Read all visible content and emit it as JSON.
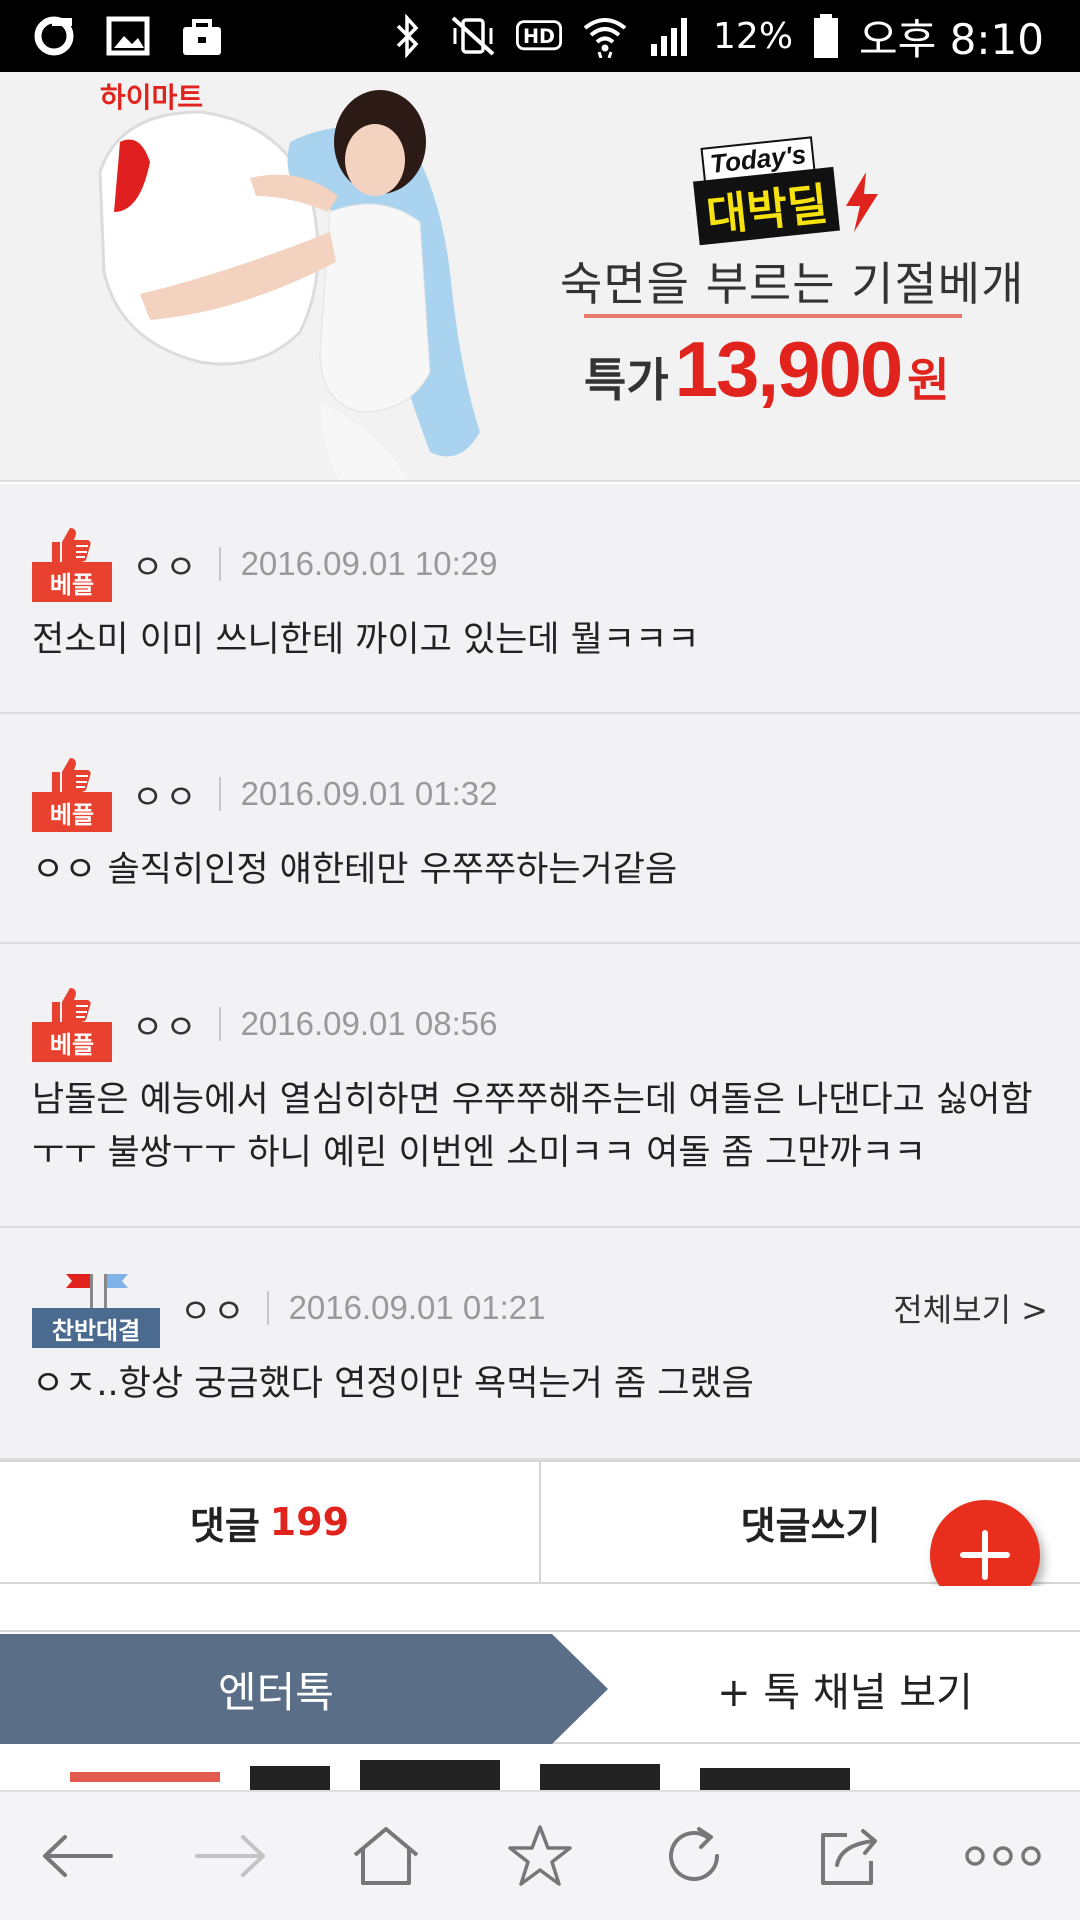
{
  "status_bar": {
    "battery_percent": "12%",
    "time": "오후 8:10",
    "icons": [
      "o-icon",
      "gallery-icon",
      "bag-icon",
      "bluetooth-icon",
      "vibrate-icon",
      "hd-icon",
      "wifi-icon",
      "signal-icon",
      "battery-icon"
    ]
  },
  "ad": {
    "brand": "하이마트",
    "deal_top": "Today's",
    "deal_main": "대박딜",
    "headline": "숙면을 부르는 기절베개",
    "price_label": "특가",
    "price_value": "13,900",
    "price_unit": "원"
  },
  "comments": [
    {
      "badge": "베플",
      "author": "ㅇㅇ",
      "date": "2016.09.01 10:29",
      "text": "전소미 이미 쓰니한테 까이고 있는데 뭘ㅋㅋㅋ"
    },
    {
      "badge": "베플",
      "author": "ㅇㅇ",
      "date": "2016.09.01 01:32",
      "text": "ㅇㅇ 솔직히인정 얘한테만 우쭈쭈하는거같음"
    },
    {
      "badge": "베플",
      "author": "ㅇㅇ",
      "date": "2016.09.01 08:56",
      "text": "남돌은 예능에서 열심히하면 우쭈쭈해주는데 여돌은 나댄다고 싫어함ㅜㅜ 불쌍ㅜㅜ 하니 예린 이번엔 소미ㅋㅋ 여돌 좀 그만까ㅋㅋ"
    },
    {
      "badge": "찬반대결",
      "author": "ㅇㅇ",
      "date": "2016.09.01 01:21",
      "view_all": "전체보기 >",
      "text": "ㅇㅈ..항상 궁금했다 연정이만 욕먹는거 좀 그랬음"
    }
  ],
  "actions": {
    "comments_label": "댓글",
    "comments_count": "199",
    "write_label": "댓글쓰기"
  },
  "channel": {
    "tab_label": "엔터톡",
    "more_label": "+ 톡 채널 보기"
  },
  "bottom_nav": [
    "back-icon",
    "forward-icon",
    "home-icon",
    "bookmark-icon",
    "refresh-icon",
    "share-icon",
    "more-icon"
  ],
  "colors": {
    "accent_red": "#e1231d",
    "best_badge": "#e8412f",
    "debate_badge": "#4a6a8f",
    "channel_tab": "#5a6e87",
    "comment_bg": "#f2f2f4"
  }
}
